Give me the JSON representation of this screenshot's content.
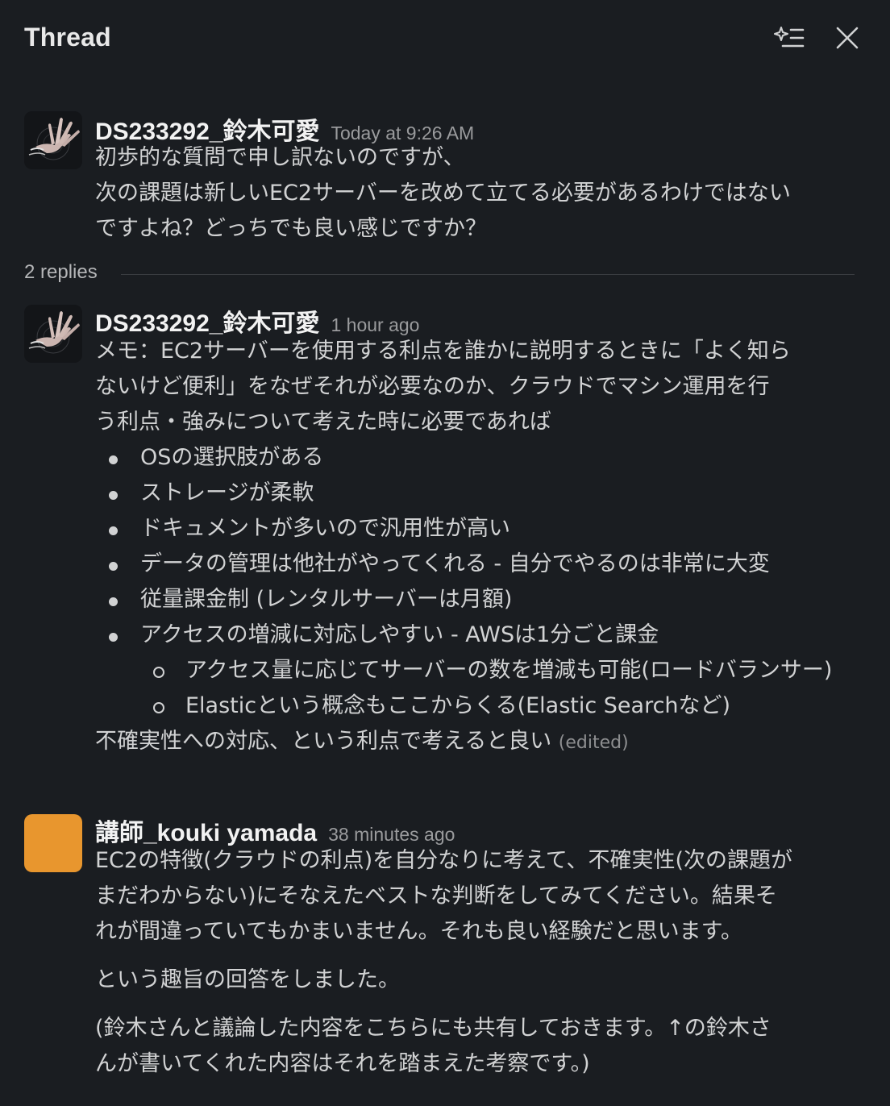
{
  "header": {
    "title": "Thread",
    "ai_icon": "sparkle-list-icon",
    "close_icon": "close-icon"
  },
  "thread": {
    "parent": {
      "sender": "DS233292_鈴木可愛",
      "timestamp": "Today at 9:26 AM",
      "lines": [
        "初歩的な質問で申し訳ないのですが、",
        "次の課題は新しいEC2サーバーを改めて立てる必要があるわけではない",
        "ですよね？どっちでも良い感じですか？"
      ]
    },
    "replies_label": "2 replies",
    "reply1": {
      "sender": "DS233292_鈴木可愛",
      "timestamp": "1 hour ago",
      "intro_lines": [
        "メモ：EC2サーバーを使用する利点を誰かに説明するときに「よく知ら",
        "ないけど便利」をなぜそれが必要なのか、クラウドでマシン運用を行",
        "う利点・強みについて考えた時に必要であれば"
      ],
      "bullets": [
        "OSの選択肢がある",
        "ストレージが柔軟",
        "ドキュメントが多いので汎用性が高い",
        "データの管理は他社がやってくれる - 自分でやるのは非常に大変",
        "従量課金制 (レンタルサーバーは月額)",
        "アクセスの増減に対応しやすい - AWSは1分ごと課金"
      ],
      "sub_bullets": [
        "アクセス量に応じてサーバーの数を増減も可能(ロードバランサー)",
        "Elasticという概念もここからくる(Elastic Searchなど)"
      ],
      "closing": "不確実性への対応、という利点で考えると良い",
      "edited": "(edited)"
    },
    "reply2": {
      "sender": "講師_kouki yamada",
      "timestamp": "38 minutes ago",
      "para1_lines": [
        "EC2の特徴(クラウドの利点)を自分なりに考えて、不確実性(次の課題が",
        "まだわからない)にそなえたベストな判断をしてみてください。結果そ",
        "れが間違っていてもかまいません。それも良い経験だと思います。"
      ],
      "para2": "という趣旨の回答をしました。",
      "para3_lines": [
        "(鈴木さんと議論した内容をこちらにも共有しておきます。↑の鈴木さ",
        "んが書いてくれた内容はそれを踏まえた考察です。)"
      ]
    }
  },
  "colors": {
    "background": "#1a1d21",
    "text": "#d1d2d3",
    "muted": "#9a9b9d",
    "avatar_orange": "#e8962e"
  }
}
